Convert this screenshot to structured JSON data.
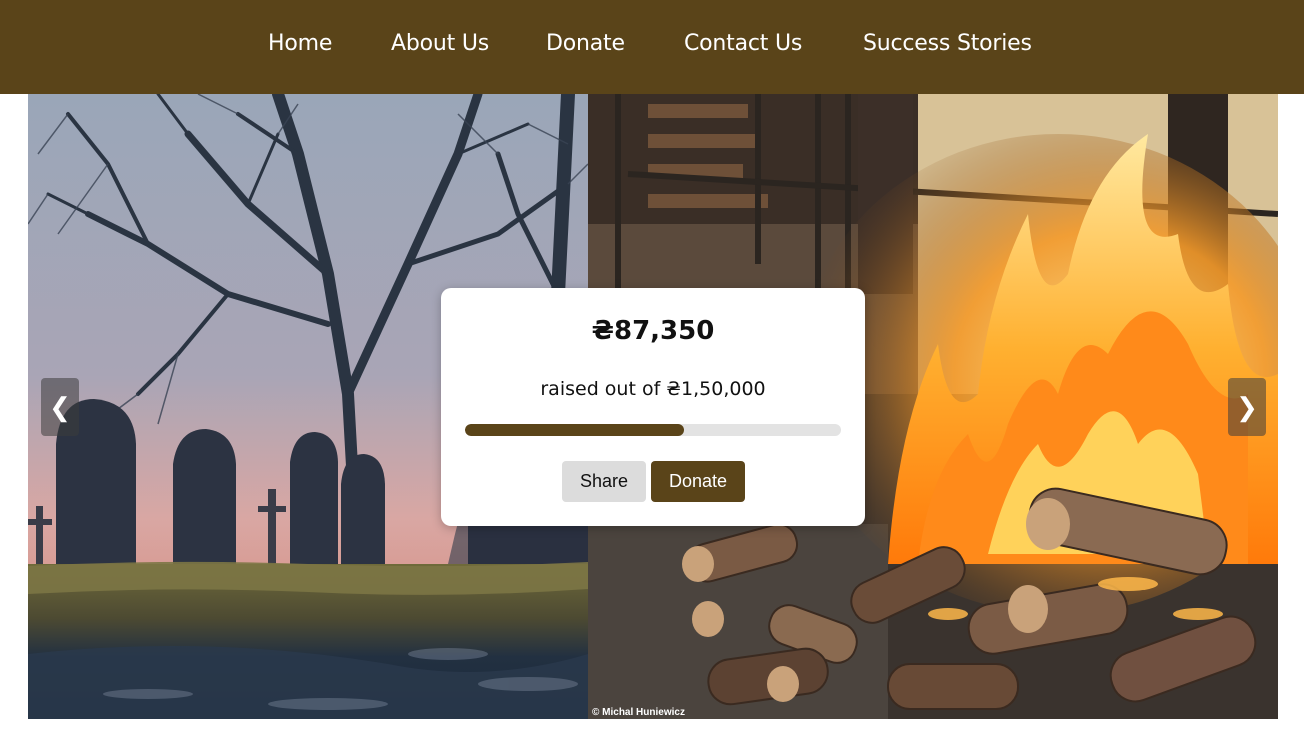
{
  "nav": {
    "home": "Home",
    "about": "About Us",
    "donate": "Donate",
    "contact": "Contact Us",
    "stories": "Success Stories"
  },
  "slider": {
    "prev_arrow": "❮",
    "next_arrow": "❯",
    "photo_credit": "© Michal Huniewicz"
  },
  "fundraiser": {
    "raised": "₴87,350",
    "raised_text": "raised out of ₴1,50,000",
    "progress_fraction": 0.582,
    "share_label": "Share",
    "donate_label": "Donate"
  },
  "colors": {
    "brand": "#5a4419",
    "track": "#e3e3e3"
  }
}
